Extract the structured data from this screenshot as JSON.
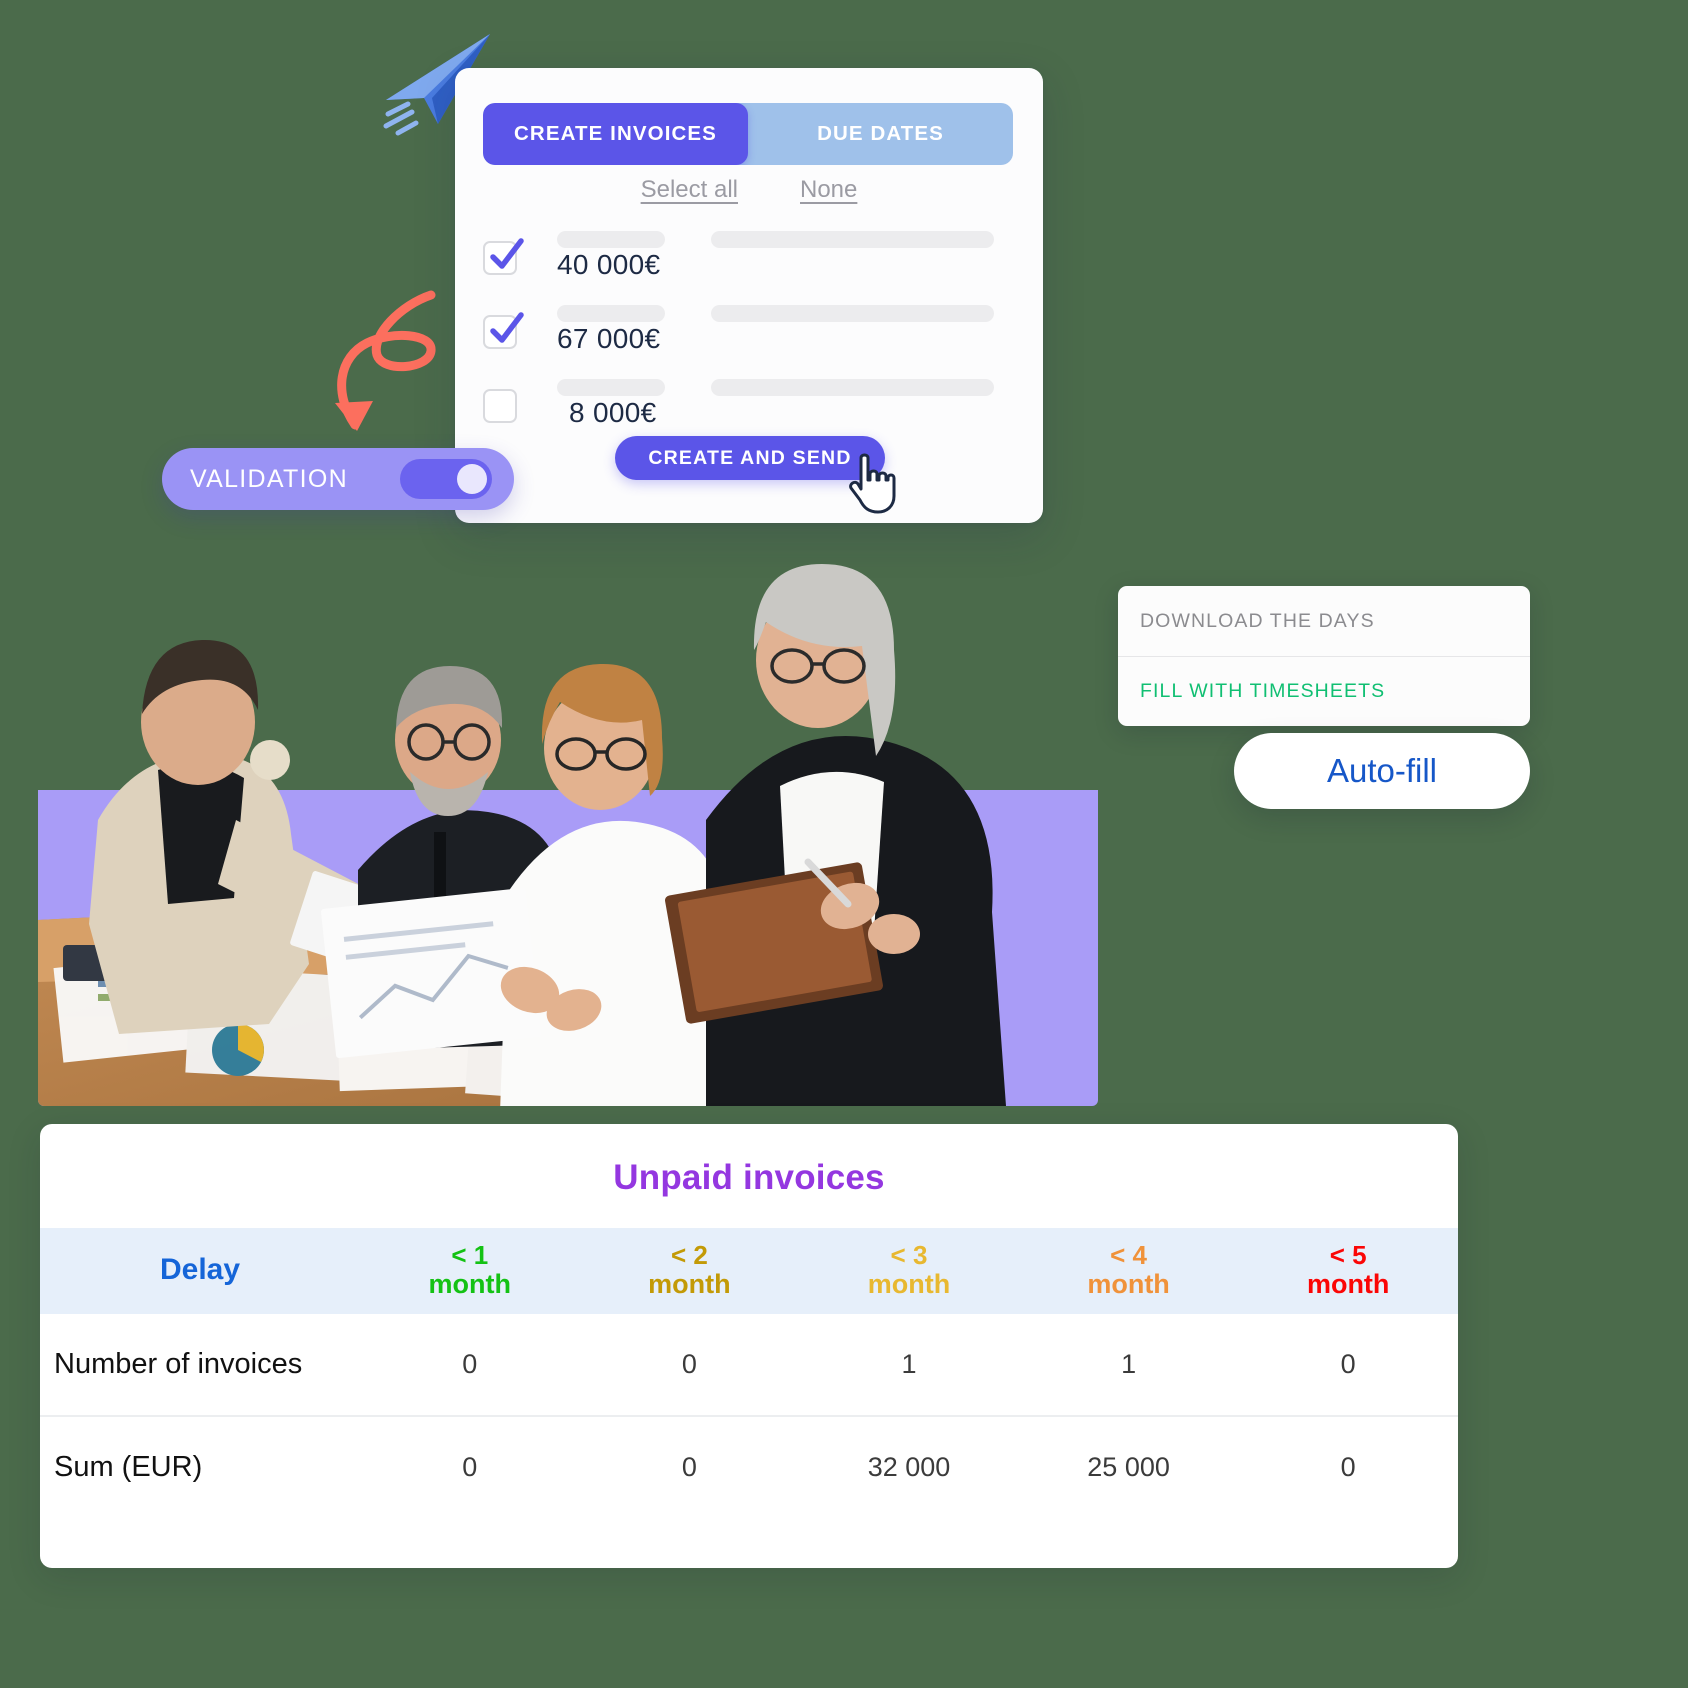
{
  "invoice_card": {
    "tabs": [
      {
        "label": "CREATE INVOICES",
        "active": true
      },
      {
        "label": "DUE DATES",
        "active": false
      }
    ],
    "select_all_label": "Select all",
    "none_label": "None",
    "rows": [
      {
        "amount": "40 000€",
        "checked": true
      },
      {
        "amount": "67 000€",
        "checked": true
      },
      {
        "amount": "8 000€",
        "checked": false
      }
    ],
    "create_send_label": "CREATE AND SEND",
    "accent_color": "#5b55e8",
    "inactive_tab_color": "#9fc1ea"
  },
  "validation": {
    "label": "VALIDATION",
    "toggle_state": "on",
    "pill_color": "#9a93f5"
  },
  "days_panel": {
    "items": [
      {
        "label": "DOWNLOAD THE DAYS",
        "color": "#8b8b8f"
      },
      {
        "label": "FILL WITH TIMESHEETS",
        "color": "#10bf72"
      }
    ],
    "autofill_label": "Auto-fill",
    "autofill_color": "#1657c8"
  },
  "unpaid_table": {
    "title": "Unpaid invoices",
    "title_color": "#9437e0"
  },
  "chart_data": {
    "type": "table",
    "title": "Unpaid invoices",
    "first_column_header": "Delay",
    "first_column_header_color": "#1565d8",
    "categories": [
      "< 1 month",
      "< 2 month",
      "< 3 month",
      "< 4 month",
      "< 5 month"
    ],
    "category_prefixes": [
      "< 1",
      "< 2",
      "< 3",
      "< 4",
      "< 5"
    ],
    "category_suffix": "month",
    "category_colors": [
      "#14c214",
      "#c39a06",
      "#e8b830",
      "#f0923a",
      "#fb0606"
    ],
    "series": [
      {
        "name": "Number of invoices",
        "values": [
          "0",
          "0",
          "1",
          "1",
          "0"
        ]
      },
      {
        "name": "Sum  (EUR)",
        "values": [
          "0",
          "0",
          "32 000",
          "25 000",
          "0"
        ]
      }
    ],
    "header_background": "#e6effa",
    "grid": true,
    "legend": "none"
  }
}
